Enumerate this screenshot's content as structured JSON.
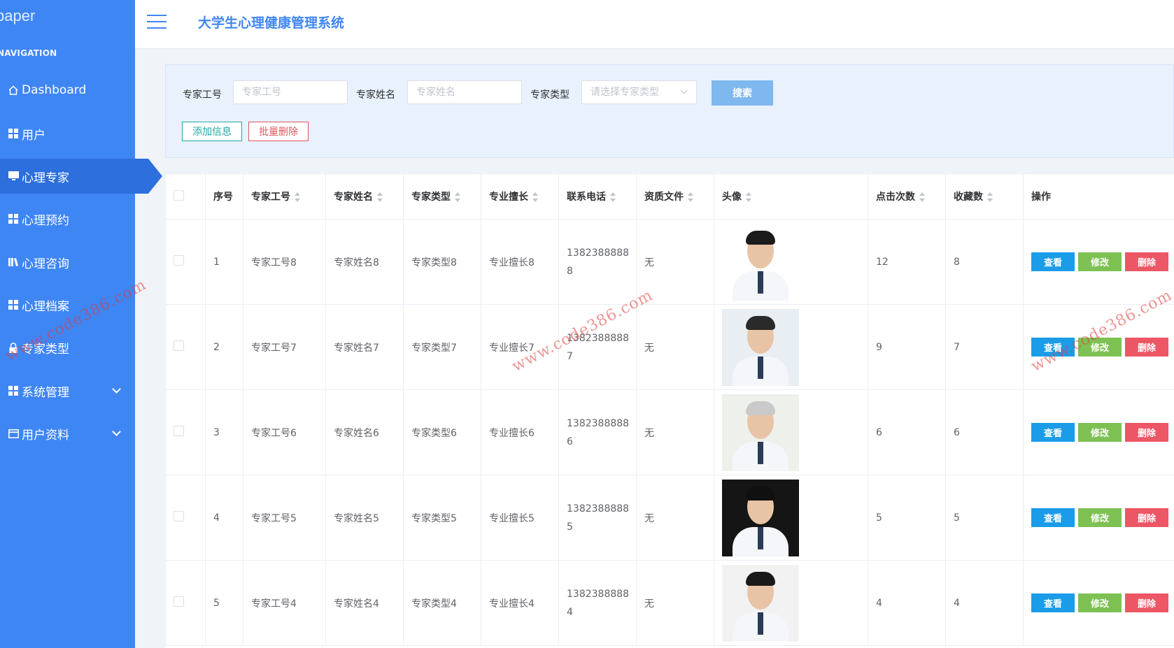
{
  "sidebar": {
    "brand": "paper",
    "heading": "NAVIGATION",
    "items": [
      {
        "label": "Dashboard",
        "icon": "home-icon"
      },
      {
        "label": "用户",
        "icon": "grid-icon"
      },
      {
        "label": "心理专家",
        "icon": "monitor-icon"
      },
      {
        "label": "心理预约",
        "icon": "grid-icon"
      },
      {
        "label": "心理咨询",
        "icon": "book-icon"
      },
      {
        "label": "心理档案",
        "icon": "grid-icon"
      },
      {
        "label": "专家类型",
        "icon": "lock-icon"
      },
      {
        "label": "系统管理",
        "icon": "grid-icon"
      },
      {
        "label": "用户资料",
        "icon": "card-icon"
      }
    ]
  },
  "header": {
    "title": "大学生心理健康管理系统"
  },
  "filter": {
    "id_label": "专家工号",
    "id_placeholder": "专家工号",
    "name_label": "专家姓名",
    "name_placeholder": "专家姓名",
    "type_label": "专家类型",
    "type_placeholder": "请选择专家类型",
    "search": "搜索",
    "add": "添加信息",
    "batch_delete": "批量删除"
  },
  "table": {
    "headers": [
      "序号",
      "专家工号",
      "专家姓名",
      "专家类型",
      "专业擅长",
      "联系电话",
      "资质文件",
      "头像",
      "点击次数",
      "收藏数",
      "操作"
    ],
    "actions": {
      "view": "查看",
      "edit": "修改",
      "delete": "删除"
    },
    "rows": [
      {
        "no": "1",
        "id": "专家工号8",
        "name": "专家姓名8",
        "type": "专家类型8",
        "skill": "专业擅长8",
        "phone1": "1382388888",
        "phone2": "8",
        "file": "无",
        "clicks": "12",
        "favs": "8"
      },
      {
        "no": "2",
        "id": "专家工号7",
        "name": "专家姓名7",
        "type": "专家类型7",
        "skill": "专业擅长7",
        "phone1": "1382388888",
        "phone2": "7",
        "file": "无",
        "clicks": "9",
        "favs": "7"
      },
      {
        "no": "3",
        "id": "专家工号6",
        "name": "专家姓名6",
        "type": "专家类型6",
        "skill": "专业擅长6",
        "phone1": "1382388888",
        "phone2": "6",
        "file": "无",
        "clicks": "6",
        "favs": "6"
      },
      {
        "no": "4",
        "id": "专家工号5",
        "name": "专家姓名5",
        "type": "专家类型5",
        "skill": "专业擅长5",
        "phone1": "1382388888",
        "phone2": "5",
        "file": "无",
        "clicks": "5",
        "favs": "5"
      },
      {
        "no": "5",
        "id": "专家工号4",
        "name": "专家姓名4",
        "type": "专家类型4",
        "skill": "专业擅长4",
        "phone1": "1382388888",
        "phone2": "4",
        "file": "无",
        "clicks": "4",
        "favs": "4"
      }
    ]
  },
  "watermark": "www.code386.com",
  "colors": {
    "sidebar": "#3f86f5",
    "active": "#2c6fdd",
    "view": "#1a9ce8",
    "edit": "#7ec153",
    "delete": "#ec5665"
  }
}
